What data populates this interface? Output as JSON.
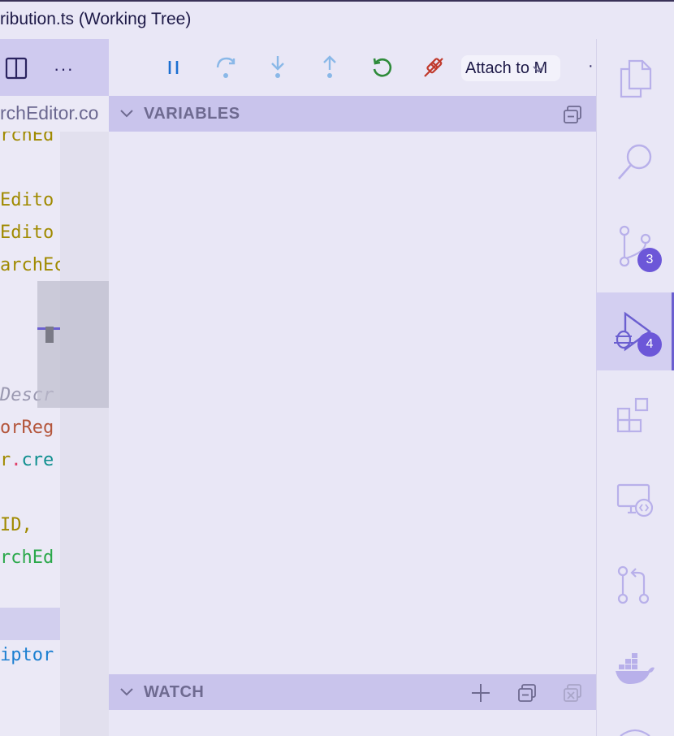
{
  "window": {
    "title": "ribution.ts (Working Tree)"
  },
  "editor": {
    "tab_label": "rchEditor.co",
    "lines": [
      {
        "text": "rchEd",
        "color": "#a08a00",
        "italic": false
      },
      {
        "text": "Edito",
        "color": "#a08a00",
        "italic": false
      },
      {
        "text": "Edito",
        "color": "#a08a00",
        "italic": false
      },
      {
        "text": "archEc",
        "color": "#a08a00",
        "italic": false
      },
      {
        "text": "Descr",
        "color": "#9a98b0",
        "italic": true
      },
      {
        "text": "orReg",
        "color": "#b4563c",
        "italic": false
      },
      {
        "text_a": "r",
        "text_b": ".",
        "text_c": "cre",
        "color": "#0f8f8f"
      },
      {
        "text": "ID,",
        "color": "#a08a00",
        "italic": false
      },
      {
        "text": "rchEd",
        "color": "#2aa84a",
        "italic": false
      },
      {
        "text": "iptor",
        "color": "#1b7fd1",
        "italic": false
      }
    ]
  },
  "debug": {
    "attach_label": "Attach to M",
    "sections": {
      "variables": "VARIABLES",
      "watch": "WATCH"
    }
  },
  "activity_bar": {
    "source_control_badge": "3",
    "run_debug_badge": "4"
  },
  "colors": {
    "accent": "#6b5fd0",
    "icon": "#b8b0ea",
    "badge": "#6c57d8"
  }
}
